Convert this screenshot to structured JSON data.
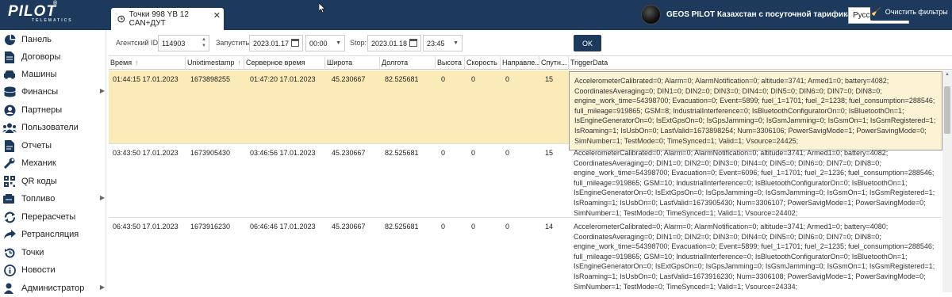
{
  "app": {
    "logo_main": "PILOT",
    "logo_sub": "TELEMATICS",
    "logo_reg": "®",
    "tab_label": "Точки 998 YB 12 CAN+ДУТ",
    "tab_close": "✕",
    "company": "GEOS PILOT Казахстан с посуточной тарификацией",
    "language": "Русский"
  },
  "sidebar": {
    "items": [
      {
        "label": "Панель",
        "icon": "dashboard-icon",
        "arrow": ""
      },
      {
        "label": "Договоры",
        "icon": "document-icon",
        "arrow": ""
      },
      {
        "label": "Машины",
        "icon": "car-icon",
        "arrow": ""
      },
      {
        "label": "Финансы",
        "icon": "coins-icon",
        "arrow": "▶"
      },
      {
        "label": "Партнеры",
        "icon": "user-circle-icon",
        "arrow": ""
      },
      {
        "label": "Пользователи",
        "icon": "users-icon",
        "arrow": ""
      },
      {
        "label": "Отчеты",
        "icon": "report-icon",
        "arrow": ""
      },
      {
        "label": "Механик",
        "icon": "wrench-icon",
        "arrow": ""
      },
      {
        "label": "QR коды",
        "icon": "qr-icon",
        "arrow": ""
      },
      {
        "label": "Топливо",
        "icon": "fuel-icon",
        "arrow": "▶"
      },
      {
        "label": "Перерасчеты",
        "icon": "recalc-icon",
        "arrow": ""
      },
      {
        "label": "Ретрансляция",
        "icon": "share-icon",
        "arrow": ""
      },
      {
        "label": "Точки",
        "icon": "history-icon",
        "arrow": ""
      },
      {
        "label": "Новости",
        "icon": "info-icon",
        "arrow": ""
      },
      {
        "label": "Администратор",
        "icon": "admin-icon",
        "arrow": "▶"
      }
    ]
  },
  "filters": {
    "agent_id_label": "Агентский ID:",
    "agent_id_value": "114903",
    "start_label": "Запустить:",
    "start_date": "2023.01.17",
    "start_time": "00:00",
    "stop_label": "Stop:",
    "stop_date": "2023.01.18",
    "stop_time": "23:45",
    "ok_label": "OK",
    "clear_label": "Очистить фильтры"
  },
  "table": {
    "columns": [
      "Время",
      "Unixtimestamp",
      "Серверное время",
      "Широта",
      "Долгота",
      "Высота",
      "Скорость",
      "Направле...",
      "Спутн...",
      "TriggerData"
    ],
    "rows": [
      {
        "time": "01:44:15 17.01.2023",
        "unix": "1673898255",
        "server_time": "01:47:20 17.01.2023",
        "lat": "45.230667",
        "lon": "82.525681",
        "alt": "0",
        "speed": "0",
        "dir": "0",
        "sats": "15",
        "trigger": "AccelerometerCalibrated=0; Alarm=0; AlarmNotification=0; altitude=3741; Armed1=0; battery=4082; CoordinatesAveraging=0; DIN1=0; DIN2=0; DIN3=0; DIN4=0; DIN5=0; DIN6=0; DIN7=0; DIN8=0; engine_work_time=54398700; Evacuation=0; Event=5899; fuel_1=1701; fuel_2=1238; fuel_consumption=288546; full_mileage=919865; GSM=8; IndustrialInterference=0; IsBluetoothConfiguratorOn=0; IsBluetoothOn=1; IsEngineGeneratorOn=0; IsExtGpsOn=0; IsGpsJamming=0; IsGsmJamming=0; IsGsmOn=1; IsGsmRegistered=1; IsRoaming=1; IsUsbOn=0; LastValid=1673898254; Num=3306106; PowerSavigMode=1; PowerSavingMode=0; SimNumber=1; TestMode=0; TimeSynced=1; Valid=1; Vsource=24425;"
      },
      {
        "time": "03:43:50 17.01.2023",
        "unix": "1673905430",
        "server_time": "03:46:56 17.01.2023",
        "lat": "45.230667",
        "lon": "82.525681",
        "alt": "0",
        "speed": "0",
        "dir": "0",
        "sats": "15",
        "trigger": "AccelerometerCalibrated=0; Alarm=0; AlarmNotification=0; altitude=3741; Armed1=0; battery=4082; CoordinatesAveraging=0; DIN1=0; DIN2=0; DIN3=0; DIN4=0; DIN5=0; DIN6=0; DIN7=0; DIN8=0; engine_work_time=54398700; Evacuation=0; Event=6096; fuel_1=1701; fuel_2=1236; fuel_consumption=288546; full_mileage=919865; GSM=10; IndustrialInterference=0; IsBluetoothConfiguratorOn=0; IsBluetoothOn=1; IsEngineGeneratorOn=0; IsExtGpsOn=0; IsGpsJamming=0; IsGsmJamming=0; IsGsmOn=1; IsGsmRegistered=1; IsRoaming=1; IsUsbOn=0; LastValid=1673905430; Num=3306107; PowerSavigMode=1; PowerSavingMode=0; SimNumber=1; TestMode=0; TimeSynced=1; Valid=1; Vsource=24402;"
      },
      {
        "time": "06:43:50 17.01.2023",
        "unix": "1673916230",
        "server_time": "06:46:46 17.01.2023",
        "lat": "45.230667",
        "lon": "82.525681",
        "alt": "0",
        "speed": "0",
        "dir": "0",
        "sats": "14",
        "trigger": "AccelerometerCalibrated=0; Alarm=0; AlarmNotification=0; altitude=3741; Armed1=0; battery=4080; CoordinatesAveraging=0; DIN1=0; DIN2=0; DIN3=0; DIN4=0; DIN5=0; DIN6=0; DIN7=0; DIN8=0; engine_work_time=54398700; Evacuation=0; Event=5899; fuel_1=1701; fuel_2=1235; fuel_consumption=288546; full_mileage=919865; GSM=10; IndustrialInterference=0; IsBluetoothConfiguratorOn=0; IsBluetoothOn=1; IsEngineGeneratorOn=0; IsExtGpsOn=0; IsGpsJamming=0; IsGsmJamming=0; IsGsmOn=1; IsGsmRegistered=1; IsRoaming=1; IsUsbOn=0; LastValid=1673916230; Num=3306108; PowerSavigMode=1; PowerSavingMode=0; SimNumber=1; TestMode=0; TimeSynced=1; Valid=1; Vsource=24334;"
      }
    ]
  },
  "colors": {
    "header_bg": "#1d3a5c",
    "selected_row": "#fbebb8",
    "button_bg": "#1d3a5c"
  }
}
